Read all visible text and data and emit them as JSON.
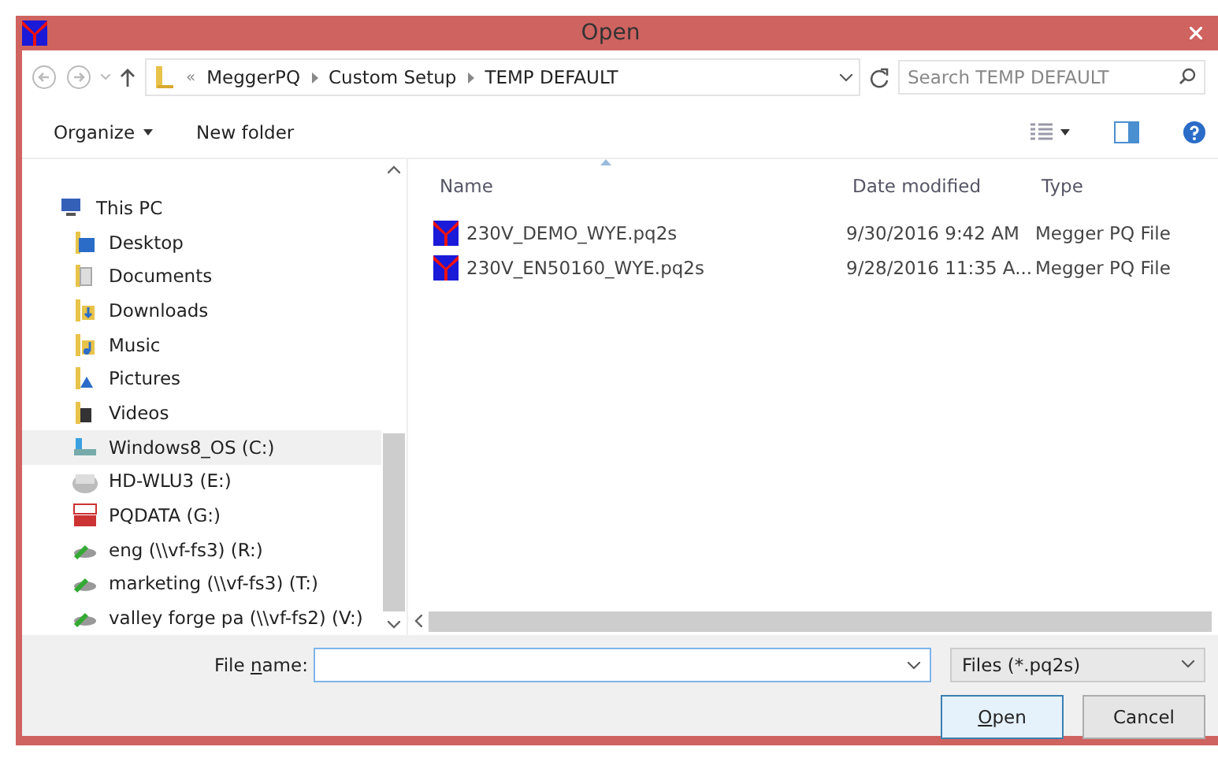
{
  "window": {
    "title": "Open"
  },
  "address": {
    "path": [
      {
        "label": "«",
        "kind": "overflow"
      },
      {
        "label": "MeggerPQ",
        "kind": "crumb"
      },
      {
        "label": "Custom Setup",
        "kind": "crumb"
      },
      {
        "label": "TEMP DEFAULT",
        "kind": "crumb"
      }
    ],
    "search_placeholder": "Search TEMP DEFAULT"
  },
  "toolbar": {
    "organize": "Organize",
    "new_folder": "New folder"
  },
  "nav": [
    {
      "label": "This PC",
      "kind": "pc",
      "selected": false,
      "children": [
        {
          "label": "Desktop",
          "kind": "desktop",
          "selected": false
        },
        {
          "label": "Documents",
          "kind": "docs",
          "selected": false
        },
        {
          "label": "Downloads",
          "kind": "downloads",
          "selected": false
        },
        {
          "label": "Music",
          "kind": "music",
          "selected": false
        },
        {
          "label": "Pictures",
          "kind": "pictures",
          "selected": false
        },
        {
          "label": "Videos",
          "kind": "videos",
          "selected": false
        },
        {
          "label": "Windows8_OS (C:)",
          "kind": "os-drive",
          "selected": true
        },
        {
          "label": "HD-WLU3 (E:)",
          "kind": "drive",
          "selected": false
        },
        {
          "label": "PQDATA (G:)",
          "kind": "sd",
          "selected": false
        },
        {
          "label": "eng (\\\\vf-fs3) (R:)",
          "kind": "network",
          "selected": false
        },
        {
          "label": "marketing (\\\\vf-fs3) (T:)",
          "kind": "network",
          "selected": false
        },
        {
          "label": "valley forge pa (\\\\vf-fs2) (V:)",
          "kind": "network",
          "selected": false
        }
      ]
    }
  ],
  "table": {
    "columns": [
      "Name",
      "Date modified",
      "Type"
    ],
    "rows": [
      {
        "name": "230V_DEMO_WYE.pq2s",
        "date": "9/30/2016 9:42 AM",
        "type": "Megger PQ File",
        "selected": false
      },
      {
        "name": "230V_EN50160_WYE.pq2s",
        "date": "9/28/2016 11:35 A...",
        "type": "Megger PQ File",
        "selected": false
      }
    ]
  },
  "footer": {
    "file_name_label": "File name:",
    "filter": "Files (*.pq2s)",
    "open": "Open",
    "cancel": "Cancel"
  }
}
